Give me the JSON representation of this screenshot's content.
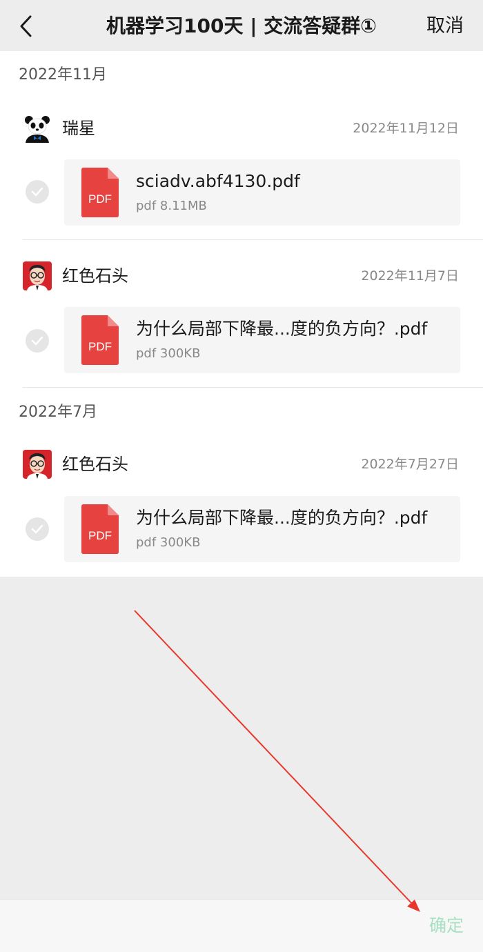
{
  "header": {
    "title": "机器学习100天 | 交流答疑群①",
    "cancel_label": "取消"
  },
  "groups": [
    {
      "month": "2022年11月",
      "items": [
        {
          "sender": "瑞星",
          "avatar": "panda-avatar",
          "date": "2022年11月12日",
          "file_name": "sciadv.abf4130.pdf",
          "file_meta": "pdf 8.11MB",
          "icon_label": "PDF"
        },
        {
          "sender": "红色石头",
          "avatar": "glasses-man-avatar",
          "date": "2022年11月7日",
          "file_name": "为什么局部下降最...度的负方向？.pdf",
          "file_meta": "pdf 300KB",
          "icon_label": "PDF"
        }
      ]
    },
    {
      "month": "2022年7月",
      "items": [
        {
          "sender": "红色石头",
          "avatar": "glasses-man-avatar",
          "date": "2022年7月27日",
          "file_name": "为什么局部下降最...度的负方向？.pdf",
          "file_meta": "pdf 300KB",
          "icon_label": "PDF"
        }
      ]
    }
  ],
  "footer": {
    "confirm_label": "确定"
  },
  "colors": {
    "pdf_red": "#e64340",
    "confirm_disabled": "#a7e0c2",
    "annotation_arrow": "#e8382d"
  }
}
